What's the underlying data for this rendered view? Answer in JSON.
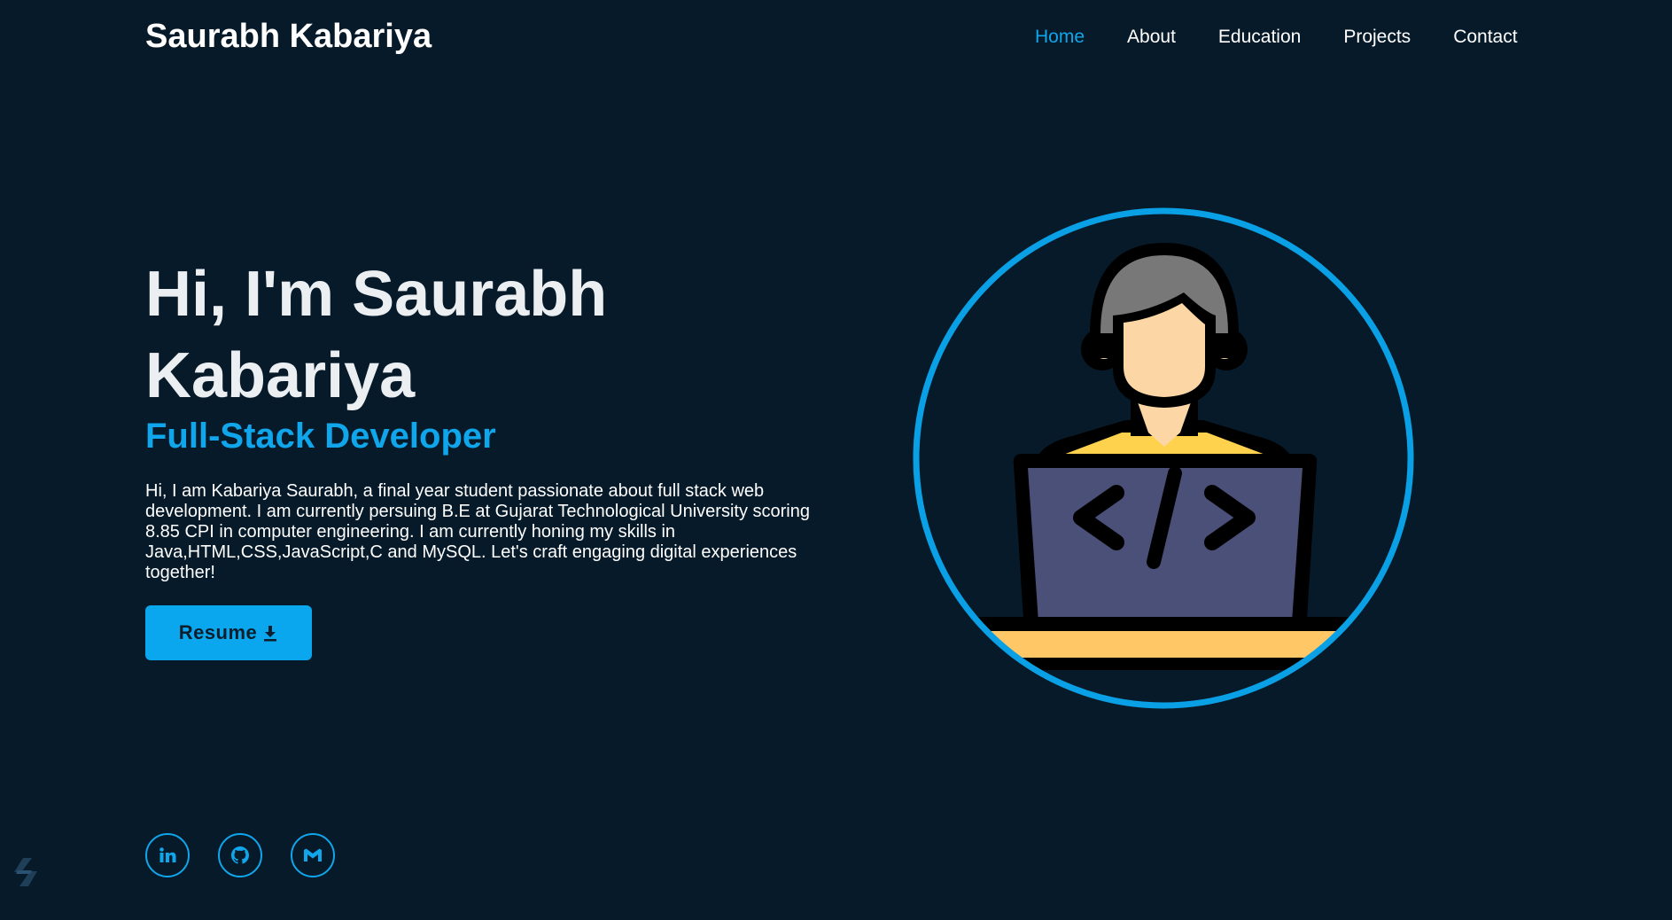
{
  "header": {
    "brand": "Saurabh Kabariya",
    "nav": [
      {
        "label": "Home",
        "active": true
      },
      {
        "label": "About",
        "active": false
      },
      {
        "label": "Education",
        "active": false
      },
      {
        "label": "Projects",
        "active": false
      },
      {
        "label": "Contact",
        "active": false
      }
    ]
  },
  "hero": {
    "title": "Hi, I'm Saurabh Kabariya",
    "subtitle": "Full-Stack Developer",
    "description": "Hi, I am Kabariya Saurabh, a final year student passionate about full stack web development. I am currently persuing B.E at Gujarat Technological University scoring 8.85 CPI in computer engineering. I am currently honing my skills in Java,HTML,CSS,JavaScript,C and MySQL. Let's craft engaging digital experiences together!",
    "resume_label": "Resume"
  },
  "socials": [
    {
      "icon": "linkedin-icon"
    },
    {
      "icon": "github-icon"
    },
    {
      "icon": "gmail-icon"
    }
  ],
  "colors": {
    "background": "#071a29",
    "accent": "#0fa6ec",
    "text": "#ffffff"
  }
}
